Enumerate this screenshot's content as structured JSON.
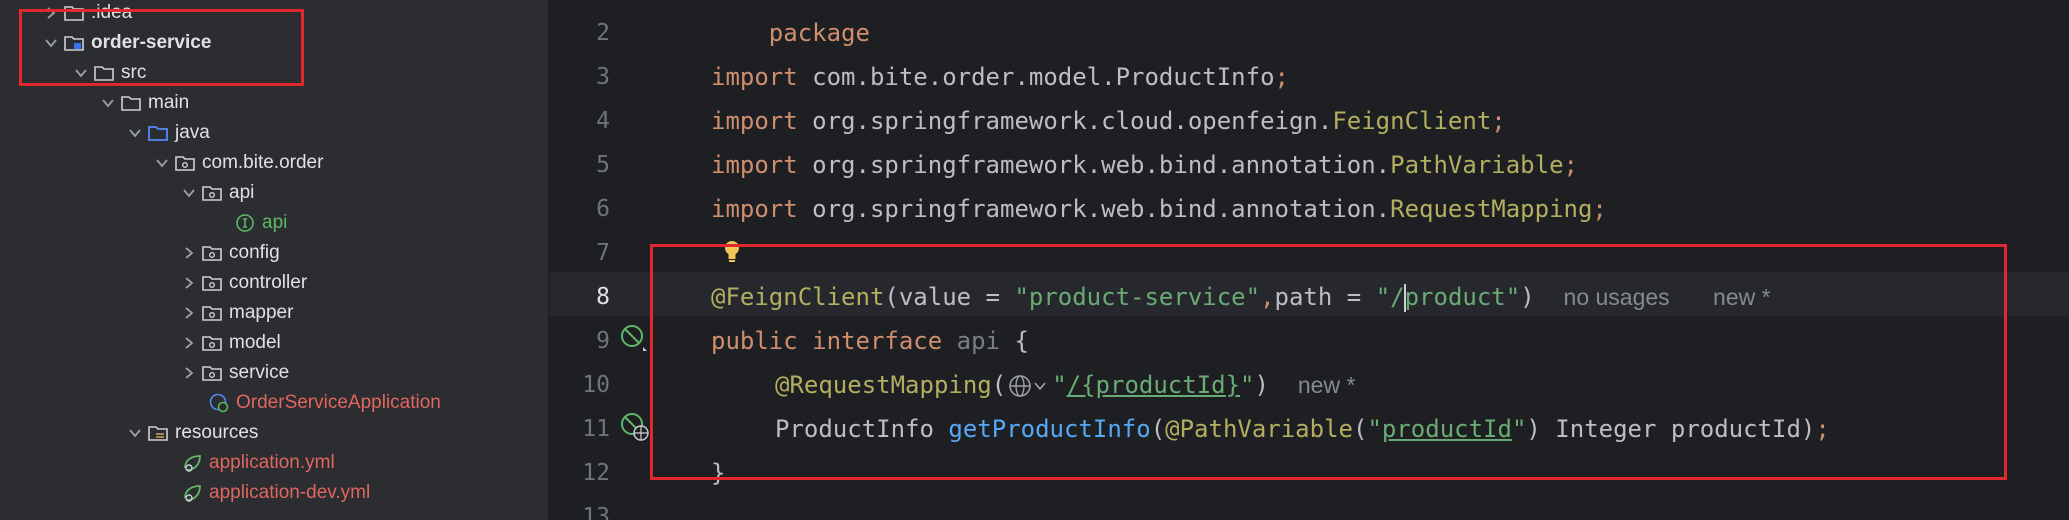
{
  "project_tree": {
    "items": [
      {
        "label": ".idea",
        "icon": "folder-icon",
        "expanded": false
      },
      {
        "label": "order-service",
        "icon": "module-folder-icon",
        "expanded": true
      },
      {
        "label": "src",
        "icon": "folder-icon",
        "expanded": true
      },
      {
        "label": "main",
        "icon": "folder-icon",
        "expanded": true
      },
      {
        "label": "java",
        "icon": "source-root-folder-icon",
        "expanded": true
      },
      {
        "label": "com.bite.order",
        "icon": "package-icon",
        "expanded": true
      },
      {
        "label": "api",
        "icon": "package-icon",
        "expanded": true
      },
      {
        "label": "api",
        "icon": "interface-icon"
      },
      {
        "label": "config",
        "icon": "package-icon",
        "expanded": false
      },
      {
        "label": "controller",
        "icon": "package-icon",
        "expanded": false
      },
      {
        "label": "mapper",
        "icon": "package-icon",
        "expanded": false
      },
      {
        "label": "model",
        "icon": "package-icon",
        "expanded": false
      },
      {
        "label": "service",
        "icon": "package-icon",
        "expanded": false
      },
      {
        "label": "OrderServiceApplication",
        "icon": "spring-boot-class-icon"
      },
      {
        "label": "resources",
        "icon": "resources-folder-icon",
        "expanded": true
      },
      {
        "label": "application.yml",
        "icon": "spring-config-icon"
      },
      {
        "label": "application-dev.yml",
        "icon": "spring-config-icon"
      }
    ]
  },
  "editor": {
    "line_numbers": [
      "2",
      "3",
      "4",
      "5",
      "6",
      "7",
      "8",
      "9",
      "10",
      "11",
      "12",
      "13"
    ],
    "lines": {
      "l3": {
        "kw": "import",
        "pkg": " com.bite.order.model.ProductInfo",
        "semi": ";"
      },
      "l4": {
        "kw": "import",
        "pkg": " org.springframework.cloud.openfeign.",
        "cls": "FeignClient",
        "semi": ";"
      },
      "l5": {
        "kw": "import",
        "pkg": " org.springframework.web.bind.annotation.",
        "cls": "PathVariable",
        "semi": ";"
      },
      "l6": {
        "kw": "import",
        "pkg": " org.springframework.web.bind.annotation.",
        "cls": "RequestMapping",
        "semi": ";"
      },
      "l8": {
        "ann": "@FeignClient",
        "p1": "(value = ",
        "s1": "\"product-service\"",
        "comma": ",",
        "p2": "path = ",
        "s2a": "\"/",
        "s2b": "product\"",
        "p3": ")",
        "hint_usages": "no usages",
        "hint_new": "new *"
      },
      "l9": {
        "kw1": "public",
        "kw2": "interface",
        "name": "api",
        "brace": " {"
      },
      "l10": {
        "ann": "@RequestMapping",
        "open": "(",
        "q1": "\"",
        "path": "/{productId}",
        "q2": "\"",
        "close": ")",
        "hint_new": "new *"
      },
      "l11": {
        "type": "ProductInfo ",
        "fn": "getProductInfo",
        "open": "(",
        "ann": "@PathVariable",
        "o2": "(",
        "q1": "\"",
        "param": "productId",
        "q2": "\"",
        "rest": ") Integer productId)",
        "semi": ";"
      },
      "l12": {
        "brace": "}"
      }
    }
  },
  "colors": {
    "highlight": "#e0282e",
    "keyword": "#cf8e6d",
    "annotation": "#b3ae60",
    "string": "#6aab73"
  }
}
